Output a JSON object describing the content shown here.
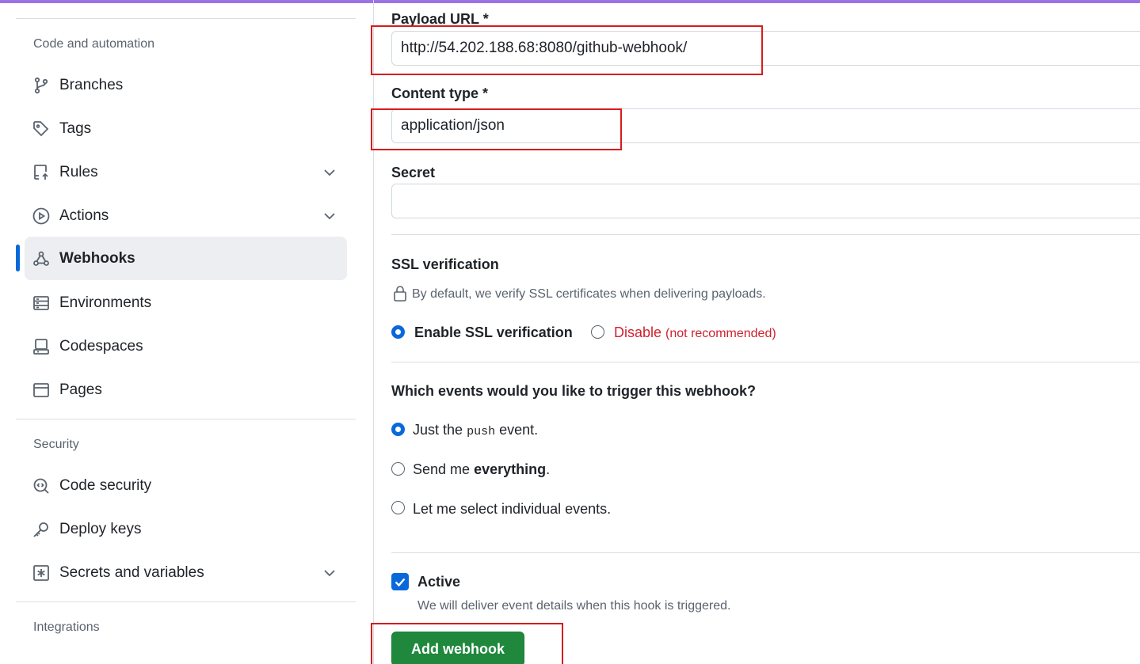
{
  "sidebar": {
    "headings": {
      "code_automation": "Code and automation",
      "security": "Security",
      "integrations": "Integrations"
    },
    "items": [
      {
        "label": "Branches",
        "icon": "git-branch-icon"
      },
      {
        "label": "Tags",
        "icon": "tag-icon"
      },
      {
        "label": "Rules",
        "icon": "repo-push-icon"
      },
      {
        "label": "Actions",
        "icon": "play-icon"
      },
      {
        "label": "Webhooks",
        "icon": "webhook-icon",
        "active": true
      },
      {
        "label": "Environments",
        "icon": "server-icon"
      },
      {
        "label": "Codespaces",
        "icon": "codespaces-icon"
      },
      {
        "label": "Pages",
        "icon": "browser-icon"
      },
      {
        "label": "Code security",
        "icon": "codescan-icon"
      },
      {
        "label": "Deploy keys",
        "icon": "key-icon"
      },
      {
        "label": "Secrets and variables",
        "icon": "asterisk-icon"
      }
    ]
  },
  "form": {
    "payload_url": {
      "label": "Payload URL *",
      "value": "http://54.202.188.68:8080/github-webhook/"
    },
    "content_type": {
      "label": "Content type *",
      "value": "application/json"
    },
    "secret": {
      "label": "Secret",
      "value": ""
    },
    "ssl": {
      "heading": "SSL verification",
      "note": "By default, we verify SSL certificates when delivering payloads.",
      "enable_label": "Enable SSL verification",
      "disable_label": "Disable",
      "disable_note": "(not recommended)",
      "selected": "enable"
    },
    "events": {
      "heading": "Which events would you like to trigger this webhook?",
      "push_before": "Just the",
      "push_code": "push",
      "push_after": "event.",
      "everything_before": "Send me",
      "everything_bold": "everything",
      "everything_after": ".",
      "individual": "Let me select individual events.",
      "selected": "push"
    },
    "active": {
      "label": "Active",
      "note": "We will deliver event details when this hook is triggered.",
      "checked": true
    },
    "submit_label": "Add webhook"
  },
  "colors": {
    "accent": "#0969da",
    "primary_button": "#1f883d",
    "danger": "#cf222e",
    "highlight": "#d81b1b"
  }
}
